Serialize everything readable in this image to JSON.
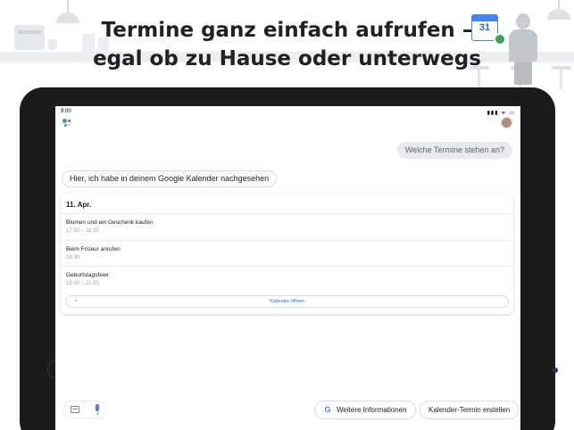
{
  "headline": {
    "line1": "Termine ganz einfach aufrufen –",
    "line2": "egal ob zu Hause oder unterwegs"
  },
  "calendar_icon": {
    "day": "31",
    "icon": "google-calendar-icon"
  },
  "tablet": {
    "status_bar": {
      "time": "9:00",
      "icons": "▮▮▮ ᯤ ▭"
    },
    "user_query": "Welche Termine stehen an?",
    "assistant_reply": "Hier, ich habe in deinem Google Kalender nachgesehen",
    "card": {
      "date": "11. Apr.",
      "events": [
        {
          "title": "Blumen und ein Geschenk kaufen",
          "time": "17:30 – 18:30"
        },
        {
          "title": "Beim Friseur anrufen",
          "time": "18:30"
        },
        {
          "title": "Geburtstagsfeier",
          "time": "19:30 – 21:00"
        }
      ],
      "open_button": "Kalender öffnen",
      "open_icon": "+"
    },
    "input": {
      "keyboard_icon": "keyboard-icon",
      "mic_icon": "microphone-icon"
    },
    "suggestions": {
      "more_info": "Weitere Informationen",
      "more_info_icon": "G",
      "create_event": "Kalender-Termin erstellen"
    }
  },
  "colors": {
    "google_blue": "#4285f4",
    "google_red": "#ea4335",
    "google_yellow": "#fbbc05",
    "google_green": "#34a853",
    "bubble_gray": "#e8eaed"
  }
}
